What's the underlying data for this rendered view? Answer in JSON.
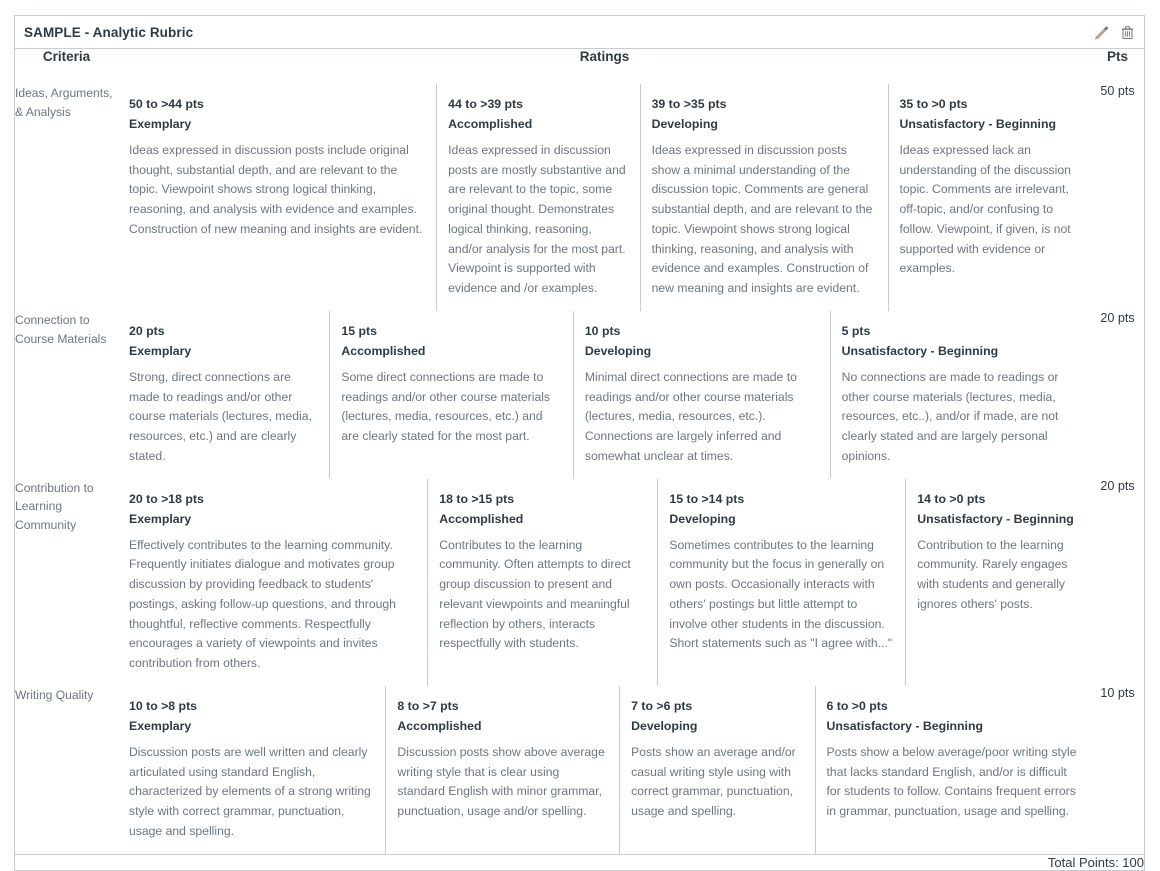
{
  "rubric": {
    "title": "SAMPLE - Analytic Rubric",
    "actions": [
      {
        "name": "edit-rubric",
        "icon": "pencil-icon",
        "label": "Edit"
      },
      {
        "name": "delete-rubric",
        "icon": "trash-icon",
        "label": "Delete"
      }
    ],
    "headers": {
      "criteria": "Criteria",
      "ratings": "Ratings",
      "pts": "Pts"
    },
    "criteria": [
      {
        "name": "Ideas, Arguments, & Analysis",
        "points": "50 pts",
        "widths": [
          33.5,
          20.5,
          25.5,
          20.5
        ],
        "ratings": [
          {
            "points": "50 to >44 pts",
            "label": "Exemplary",
            "description": "Ideas expressed in discussion posts include original thought, substantial depth, and are relevant to the topic. Viewpoint shows strong logical thinking, reasoning, and analysis with evidence and examples. Construction of new meaning and insights are evident."
          },
          {
            "points": "44 to >39 pts",
            "label": "Accomplished",
            "description": "Ideas expressed in discussion posts are mostly substantive and are relevant to the topic, some original thought. Demonstrates logical thinking, reasoning, and/or analysis for the most part. Viewpoint is supported with evidence and /or examples."
          },
          {
            "points": "39 to >35 pts",
            "label": "Developing",
            "description": "Ideas expressed in discussion posts show a minimal understanding of the discussion topic. Comments are general substantial depth, and are relevant to the topic. Viewpoint shows strong logical thinking, reasoning, and analysis with evidence and examples. Construction of new meaning and insights are evident."
          },
          {
            "points": "35 to >0 pts",
            "label": "Unsatisfactory - Beginning",
            "description": "Ideas expressed lack an understanding of the discussion topic. Comments are irrelevant, off-topic, and/or confusing to follow. Viewpoint, if given, is not supported with evidence or examples."
          }
        ]
      },
      {
        "name": "Connection to Course Materials",
        "points": "20 pts",
        "widths": [
          21.5,
          25,
          26.5,
          27
        ],
        "ratings": [
          {
            "points": "20 pts",
            "label": "Exemplary",
            "description": "Strong, direct connections are made to readings and/or other course materials (lectures, media, resources, etc.) and are clearly stated."
          },
          {
            "points": "15 pts",
            "label": "Accomplished",
            "description": "Some direct connections are made to readings and/or other course materials (lectures, media, resources, etc.) and are clearly stated for the most part."
          },
          {
            "points": "10 pts",
            "label": "Developing",
            "description": "Minimal direct connections are made to readings and/or other course materials (lectures, media, resources, etc.). Connections are largely inferred and somewhat unclear at times."
          },
          {
            "points": "5 pts",
            "label": "Unsatisfactory - Beginning",
            "description": "No connections are made to readings or other course materials (lectures, media, resources, etc..), and/or if made, are not clearly stated and are largely personal opinions."
          }
        ]
      },
      {
        "name": "Contribution to Learning Community",
        "points": "20 pts",
        "widths": [
          32.5,
          23.5,
          25.5,
          18.5
        ],
        "ratings": [
          {
            "points": "20 to >18 pts",
            "label": "Exemplary",
            "description": "Effectively contributes to the learning community. Frequently initiates dialogue and motivates group discussion by providing feedback to students' postings, asking follow-up questions, and through thoughtful, reflective comments. Respectfully encourages a variety of viewpoints and invites contribution from others."
          },
          {
            "points": "18 to >15 pts",
            "label": "Accomplished",
            "description": "Contributes to the learning community. Often attempts to direct group discussion to present and relevant viewpoints and meaningful reflection by others, interacts respectfully with students."
          },
          {
            "points": "15 to >14 pts",
            "label": "Developing",
            "description": "Sometimes contributes to the learning community but the focus in generally on own posts. Occasionally interacts with others' postings but little attempt to involve other students in the discussion. Short statements such as \"I agree with...\""
          },
          {
            "points": "14 to >0 pts",
            "label": "Unsatisfactory - Beginning",
            "description": "Contribution to the learning community. Rarely engages with students and generally ignores others' posts."
          }
        ]
      },
      {
        "name": "Writing Quality",
        "points": "10 pts",
        "widths": [
          27.8,
          23.9,
          19.6,
          28.7
        ],
        "ratings": [
          {
            "points": "10 to >8 pts",
            "label": "Exemplary",
            "description": "Discussion posts are well written and clearly articulated using standard English, characterized by elements of a strong writing style with correct grammar, punctuation, usage and spelling."
          },
          {
            "points": "8 to >7 pts",
            "label": "Accomplished",
            "description": "Discussion posts show above average writing style that is clear using standard English with minor grammar, punctuation, usage and/or spelling."
          },
          {
            "points": "7 to >6 pts",
            "label": "Developing",
            "description": "Posts show an average and/or casual writing style using with correct grammar, punctuation, usage and spelling."
          },
          {
            "points": "6 to >0 pts",
            "label": "Unsatisfactory - Beginning",
            "description": "Posts show a below average/poor writing style that lacks standard English, and/or is difficult for students to follow. Contains frequent errors in grammar, punctuation, usage and spelling."
          }
        ]
      }
    ],
    "total": "Total Points: 100"
  }
}
